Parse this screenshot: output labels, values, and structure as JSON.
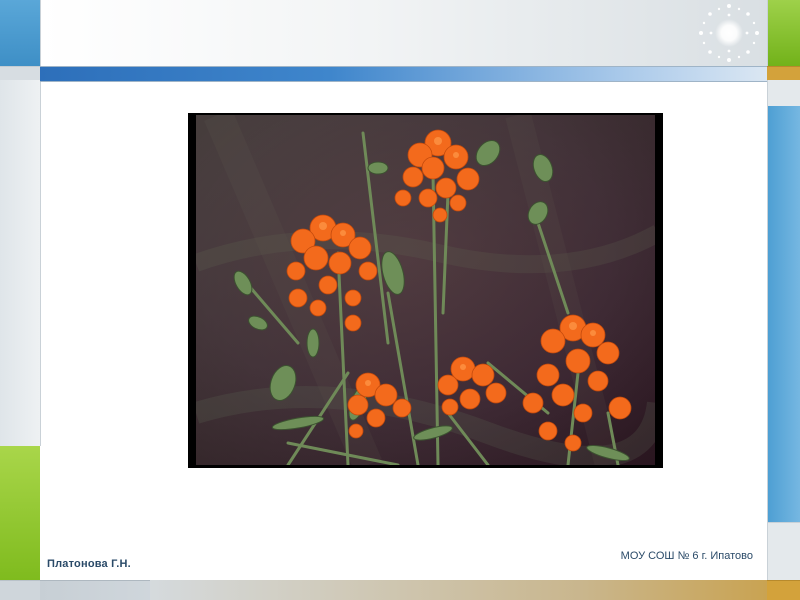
{
  "footer": {
    "author": "Платонова Г.Н.",
    "school": "МОУ СОШ № 6 г. Ипатово"
  },
  "colors": {
    "left_top_blue": "#4a9ad0",
    "left_green": "#92c934",
    "header_bar_blue": "#2d6fba",
    "right_top_green": "#85c12c",
    "right_blue": "#5aa7d8",
    "gold": "#d3a23b",
    "footer_text": "#2a4a68",
    "flower_orange": "#f36a1c",
    "photo_background": "#3a2230"
  },
  "icons": {
    "logo": "sparkle-icon"
  }
}
